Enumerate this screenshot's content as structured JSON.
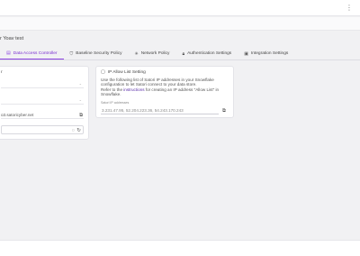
{
  "header": {
    "more_icon": "more-vertical-icon"
  },
  "breadcrumb": {
    "text": "r Yoav test"
  },
  "tabs": [
    {
      "label": "Data Access Controller",
      "icon": "list-icon",
      "active": true
    },
    {
      "label": "Baseline Security Policy",
      "icon": "shield-icon",
      "active": false
    },
    {
      "label": "Network Policy",
      "icon": "network-icon",
      "active": false
    },
    {
      "label": "Authentication Settings",
      "icon": "lock-icon",
      "active": false
    },
    {
      "label": "Integration Settings",
      "icon": "database-icon",
      "active": false
    }
  ],
  "left_panel": {
    "label": "r",
    "hostname": "o3.satoricyber.net"
  },
  "right_panel": {
    "title": "IP Allow List Setting",
    "desc_line1": "Use the following list of Satori IP addresses in your Snowflake",
    "desc_line2": "configuration to let Satori connect to your data store.",
    "desc_line3_pre": "Refer to the ",
    "desc_link": "instructions",
    "desc_line3_post": " for creating an IP address \"Allow List\" in",
    "desc_line4": "Snowflake.",
    "ip_label": "Satori IP addresses",
    "ip_value": "3.231.47.95,  52.204.223.36,  54.243.170.243"
  },
  "colors": {
    "accent": "#8a3fe0",
    "link": "#5a2ea8"
  }
}
